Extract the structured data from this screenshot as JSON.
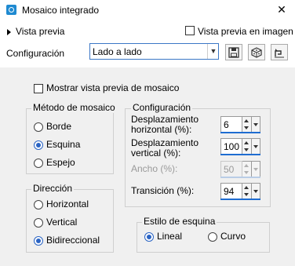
{
  "window": {
    "title": "Mosaico integrado",
    "close_symbol": "✕"
  },
  "header": {
    "preview_label": "Vista previa",
    "preview_in_image_label": "Vista previa en imagen",
    "preview_in_image_checked": false,
    "config_label": "Configuración",
    "config_value": "Lado a lado",
    "tools": [
      {
        "name": "save-preset-icon",
        "glyph": "💾"
      },
      {
        "name": "random-dice-icon",
        "glyph": "⚄"
      },
      {
        "name": "reset-icon",
        "glyph": "↶"
      }
    ]
  },
  "show_mosaic_preview": {
    "label": "Mostrar vista previa de mosaico",
    "checked": false
  },
  "method": {
    "title": "Método de mosaico",
    "options": [
      "Borde",
      "Esquina",
      "Espejo"
    ],
    "selected": "Esquina"
  },
  "direction": {
    "title": "Dirección",
    "options": [
      "Horizontal",
      "Vertical",
      "Bidireccional"
    ],
    "selected": "Bidireccional"
  },
  "settings": {
    "title": "Configuración",
    "h_offset": {
      "label_line1": "Desplazamiento",
      "label_line2": "horizontal (%):",
      "value": "6"
    },
    "v_offset": {
      "label_line1": "Desplazamiento",
      "label_line2": "vertical (%):",
      "value": "100"
    },
    "width": {
      "label": "Ancho (%):",
      "value": "50",
      "disabled": true
    },
    "transition": {
      "label": "Transición (%):",
      "value": "94"
    }
  },
  "corner_style": {
    "title": "Estilo de esquina",
    "options": [
      "Lineal",
      "Curvo"
    ],
    "selected": "Lineal"
  },
  "colors": {
    "accent": "#1f6dd1",
    "panel": "#f0f0f0",
    "icon_blue": "#1f8ad1"
  }
}
